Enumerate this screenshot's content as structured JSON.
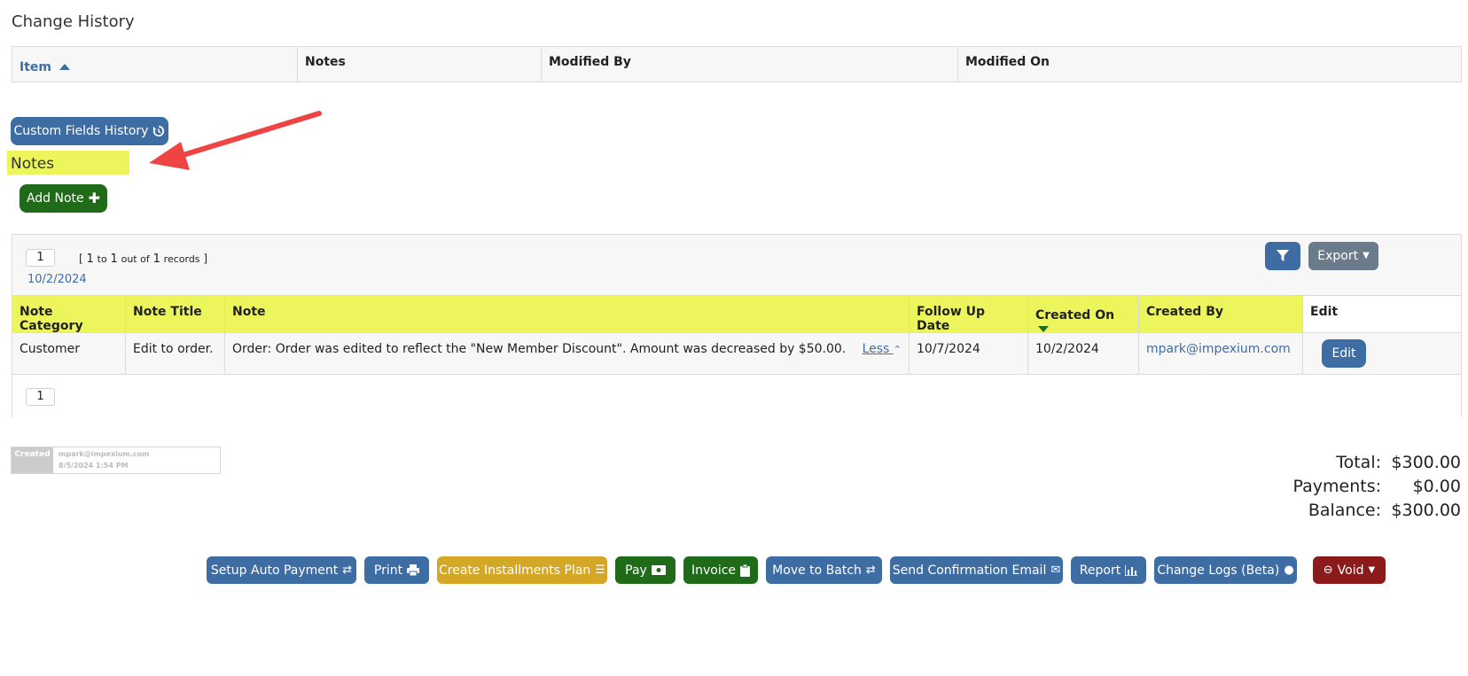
{
  "change_history": {
    "title": "Change History",
    "columns": {
      "item": "Item",
      "notes": "Notes",
      "modified_by": "Modified By",
      "modified_on": "Modified On"
    }
  },
  "custom_fields_button": "Custom Fields History",
  "notes_section": {
    "title": "Notes",
    "add_button": "Add Note",
    "pager": {
      "page": "1",
      "lb": "[",
      "from": "1",
      "to_word": "to",
      "to": "1",
      "out_of": "out of",
      "total": "1",
      "records": "records",
      "rb": "]"
    },
    "date_label": "10/2/2024",
    "export_label": "Export",
    "headers": {
      "category": "Note Category",
      "title": "Note Title",
      "note": "Note",
      "follow_up": "Follow Up Date",
      "created_on": "Created On",
      "created_by": "Created By",
      "edit": "Edit"
    },
    "row": {
      "category": "Customer",
      "title": "Edit to order.",
      "note": "Order: Order was edited to reflect the \"New Member Discount\". Amount was decreased by $50.00.",
      "less": "Less",
      "follow_up": "10/7/2024",
      "created_on": "10/2/2024",
      "created_by": "mpark@impexium.com",
      "edit": "Edit"
    },
    "bottom_page": "1"
  },
  "created_stamp": {
    "label": "Created",
    "user": "mpark@impexium.com",
    "date": "8/5/2024 1:54 PM"
  },
  "summary": {
    "total_label": "Total:",
    "total": "$300.00",
    "payments_label": "Payments:",
    "payments": "$0.00",
    "balance_label": "Balance:",
    "balance": "$300.00"
  },
  "actions": {
    "setup_auto_payment": "Setup Auto Payment",
    "print": "Print",
    "installments": "Create Installments Plan",
    "pay": "Pay",
    "invoice": "Invoice",
    "move_batch": "Move to Batch",
    "send_email": "Send Confirmation Email",
    "report": "Report",
    "change_logs": "Change Logs (Beta)",
    "void": "Void"
  },
  "colors": {
    "primary": "#3e6da4",
    "success": "#1f6b1a",
    "warning": "#d4a826",
    "danger": "#8b1a1a",
    "highlight": "#ecf55c",
    "annotation": "#ef4444"
  }
}
